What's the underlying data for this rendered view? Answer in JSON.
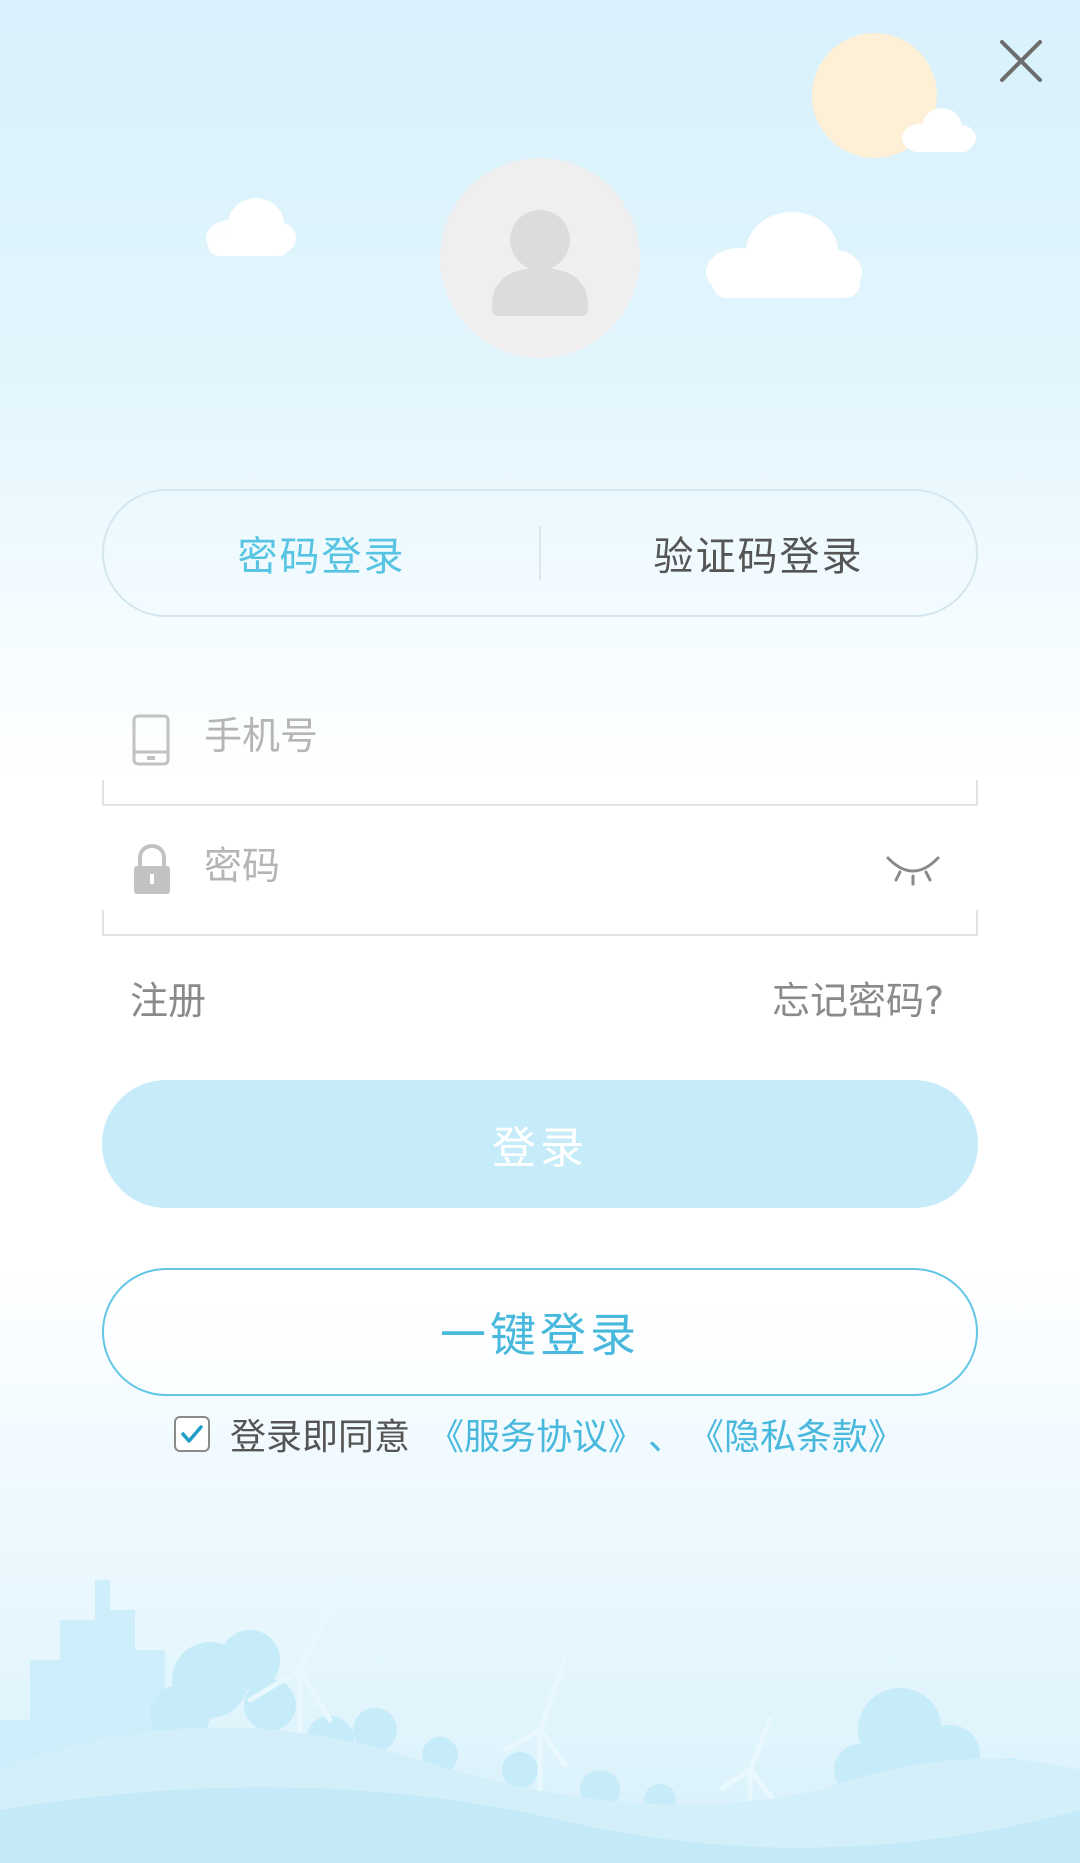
{
  "tabs": {
    "password_login": "密码登录",
    "code_login": "验证码登录"
  },
  "phone_field": {
    "placeholder": "手机号",
    "value": ""
  },
  "password_field": {
    "placeholder": "密码",
    "value": ""
  },
  "links": {
    "register": "注册",
    "forgot_password": "忘记密码?"
  },
  "buttons": {
    "login": "登录",
    "one_key_login": "一键登录"
  },
  "agreement": {
    "checked": true,
    "prefix": "登录即同意",
    "service_terms": "《服务协议》",
    "separator": "、",
    "privacy_terms": "《隐私条款》"
  },
  "icons": {
    "close": "close-icon",
    "avatar": "user-avatar-icon",
    "phone": "phone-icon",
    "lock": "lock-icon",
    "eye": "eye-closed-icon",
    "check": "check-icon"
  },
  "colors": {
    "accent": "#56c4e2",
    "login_button_bg": "#c6ecfa",
    "sky": "#d8f1fc"
  }
}
